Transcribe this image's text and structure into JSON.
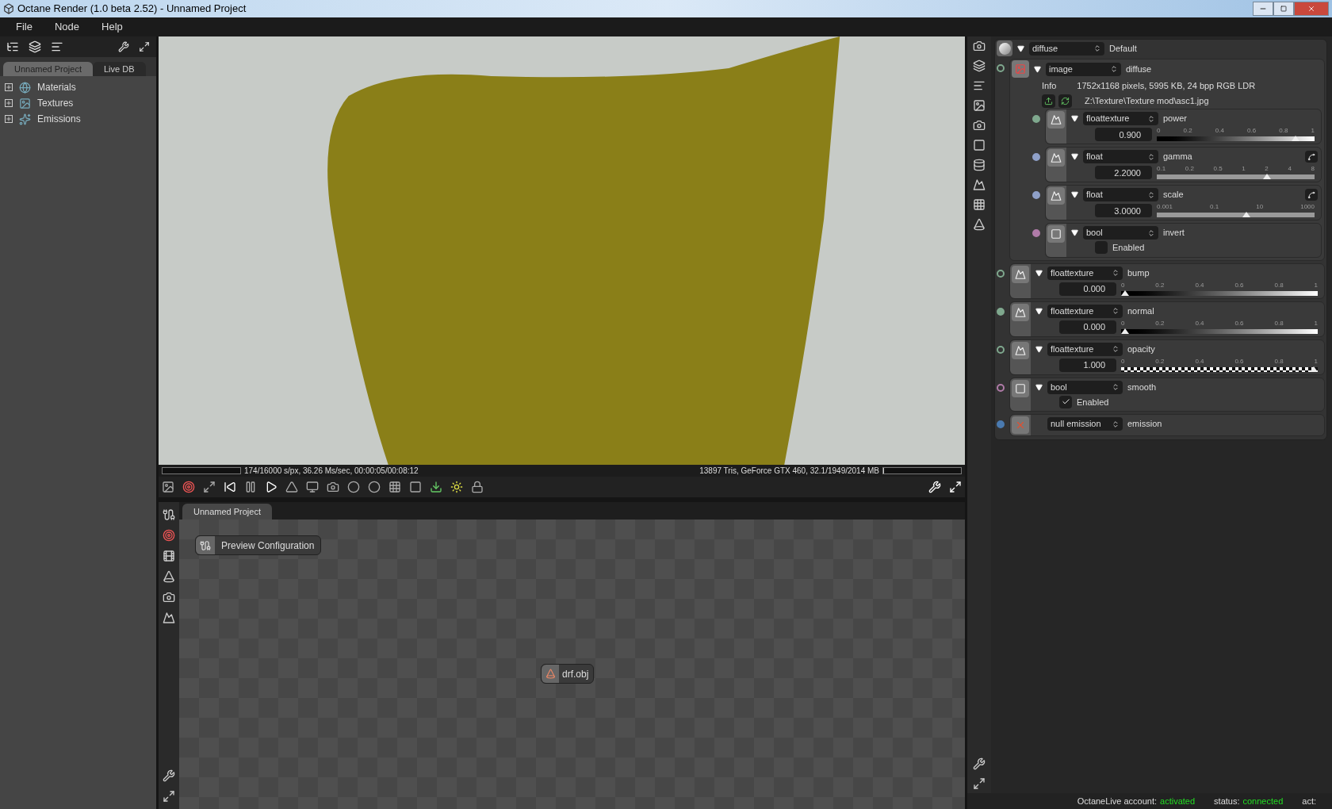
{
  "window": {
    "title": "Octane Render (1.0 beta 2.52) - Unnamed Project"
  },
  "menu": [
    "File",
    "Node",
    "Help"
  ],
  "project_panel": {
    "tabs": [
      {
        "label": "Unnamed Project",
        "selected": true
      },
      {
        "label": "Live DB",
        "selected": false
      }
    ],
    "tree": [
      {
        "label": "Materials",
        "expanded": false
      },
      {
        "label": "Textures",
        "expanded": false
      },
      {
        "label": "Emissions",
        "expanded": false
      }
    ]
  },
  "viewport": {
    "progress": {
      "level": 0
    },
    "stats": "174/16000 s/px, 36.26 Ms/sec, 00:00:05/00:08:12",
    "scene_info": "13897 Tris, GeForce GTX 460, 32.1/1949/2014 MB",
    "memory": {
      "level": 0.01
    }
  },
  "node_editor": {
    "tab": "Unnamed Project",
    "nodes": [
      {
        "label": "Preview Configuration",
        "kind": "config"
      },
      {
        "label": "drf.obj",
        "kind": "mesh"
      }
    ]
  },
  "inspector": {
    "type": "diffuse",
    "name": "Default",
    "texture": {
      "type": "image",
      "name": "diffuse",
      "pin": {
        "color": "#7fa88e",
        "connected": false
      },
      "info_label": "Info",
      "info": "1752x1168 pixels, 5995 KB, 24 bpp RGB LDR",
      "path": "Z:\\Texture\\Texture mod\\asc1.jpg",
      "params": [
        {
          "kind": "slider",
          "type": "floattexture",
          "name": "power",
          "value": "0.900",
          "ticks": [
            "0",
            "0.2",
            "0.4",
            "0.6",
            "0.8",
            "1"
          ],
          "level": 0.9,
          "track": {
            "kind": "gradient"
          },
          "curve": false,
          "pin": {
            "color": "#7fa88e",
            "connected": true
          }
        },
        {
          "kind": "slider",
          "type": "float",
          "name": "gamma",
          "value": "2.2000",
          "ticks": [
            "0.1",
            "0.2",
            "0.5",
            "1",
            "2",
            "4",
            "8"
          ],
          "level": 0.71,
          "track": {
            "kind": "plain"
          },
          "curve": true,
          "pin": {
            "color": "#8fa0c8",
            "connected": true
          }
        },
        {
          "kind": "slider",
          "type": "float",
          "name": "scale",
          "value": "3.0000",
          "ticks": [
            "0.001",
            "0.1",
            "10",
            "1000"
          ],
          "level": 0.57,
          "track": {
            "kind": "plain"
          },
          "curve": true,
          "pin": {
            "color": "#8fa0c8",
            "connected": true
          }
        },
        {
          "kind": "bool",
          "type": "bool",
          "name": "invert",
          "option": "Enabled",
          "checked": false,
          "pin": {
            "color": "#b07ba8",
            "connected": true
          }
        }
      ]
    },
    "params": [
      {
        "kind": "slider",
        "type": "floattexture",
        "name": "bump",
        "value": "0.000",
        "ticks": [
          "0",
          "0.2",
          "0.4",
          "0.6",
          "0.8",
          "1"
        ],
        "level": 0,
        "track": {
          "kind": "gradient"
        },
        "curve": false,
        "pin": {
          "color": "#7fa88e",
          "connected": false
        }
      },
      {
        "kind": "slider",
        "type": "floattexture",
        "name": "normal",
        "value": "0.000",
        "ticks": [
          "0",
          "0.2",
          "0.4",
          "0.6",
          "0.8",
          "1"
        ],
        "level": 0,
        "track": {
          "kind": "gradient"
        },
        "curve": false,
        "pin": {
          "color": "#7fa88e",
          "connected": true
        }
      },
      {
        "kind": "slider",
        "type": "floattexture",
        "name": "opacity",
        "value": "1.000",
        "ticks": [
          "0",
          "0.2",
          "0.4",
          "0.6",
          "0.8",
          "1"
        ],
        "level": 1,
        "track": {
          "kind": "checker"
        },
        "curve": false,
        "pin": {
          "color": "#7fa88e",
          "connected": false
        }
      },
      {
        "kind": "bool",
        "type": "bool",
        "name": "smooth",
        "option": "Enabled",
        "checked": true,
        "pin": {
          "color": "#b07ba8",
          "connected": false
        }
      },
      {
        "kind": "emission",
        "type": "null emission",
        "name": "emission",
        "pin": {
          "color": "#4a7ab0",
          "connected": true
        }
      }
    ]
  },
  "status": {
    "account_label": "OctaneLive account:",
    "account": "activated",
    "status_label": "status:",
    "status": "connected",
    "act_label": "act:"
  }
}
